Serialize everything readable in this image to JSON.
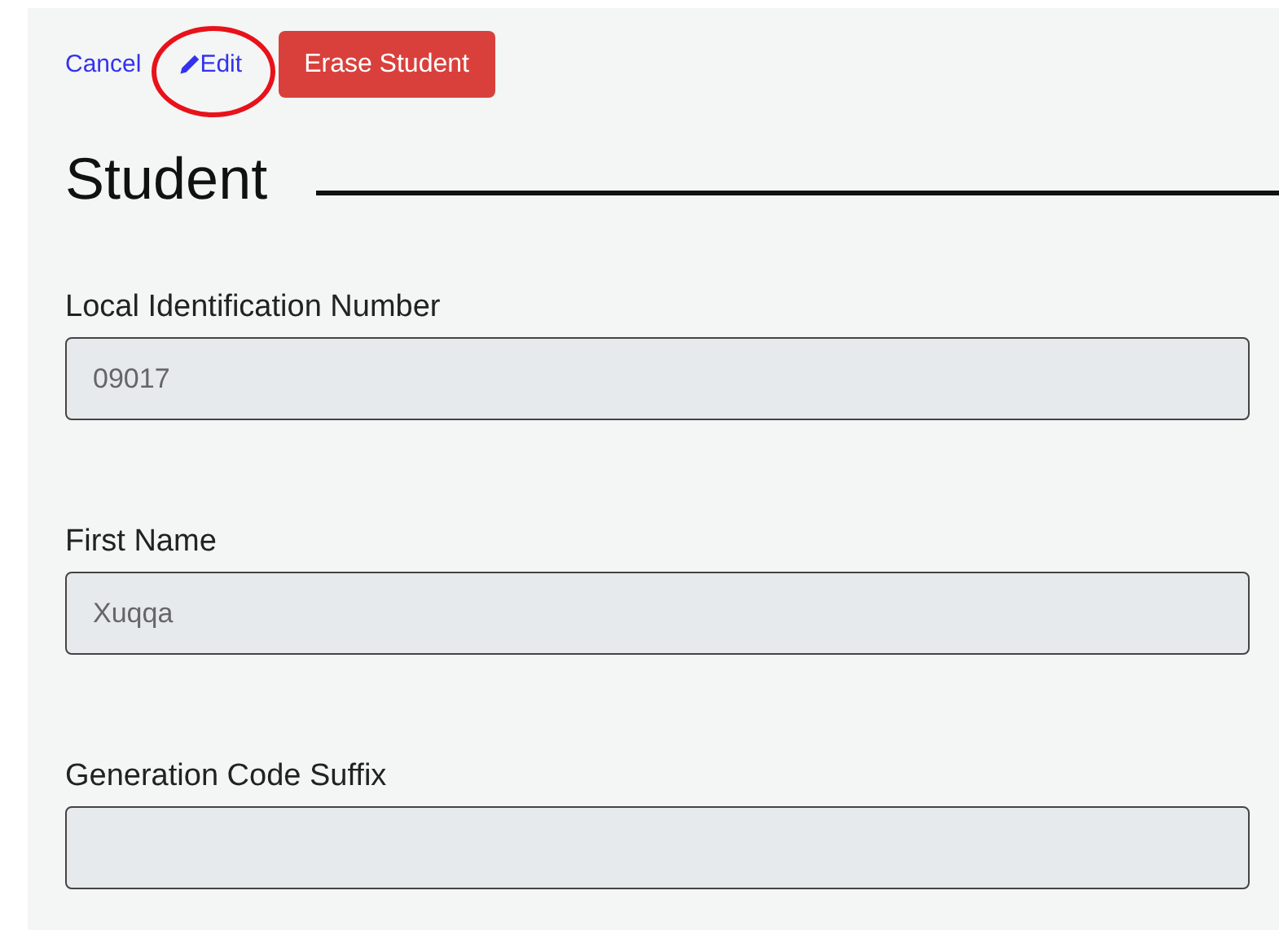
{
  "toolbar": {
    "cancel": "Cancel",
    "edit": "Edit",
    "erase": "Erase Student",
    "edit_circled": true
  },
  "heading": "Student",
  "fields": [
    {
      "label": "Local Identification Number",
      "value": "09017",
      "disabled": true
    },
    {
      "label": "First Name",
      "value": "Xuqqa",
      "disabled": true
    },
    {
      "label": "Generation Code Suffix",
      "disabled": true
    }
  ]
}
